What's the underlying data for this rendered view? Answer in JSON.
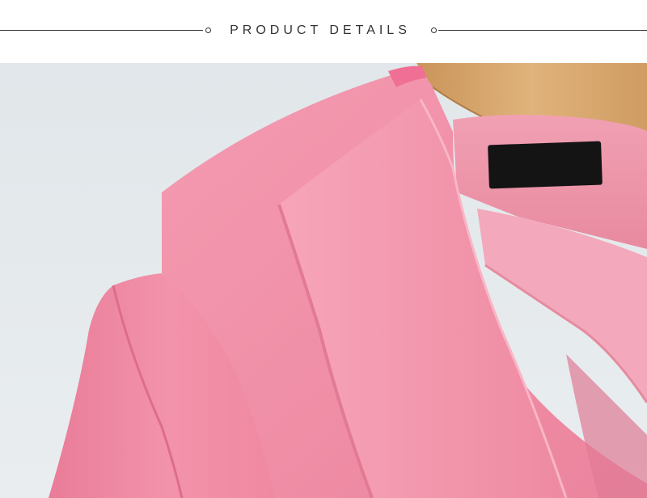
{
  "header": {
    "title": "PRODUCT DETAILS"
  },
  "photo": {
    "subject": "pink-blazer-closeup",
    "colors": {
      "background": "#e4e9ec",
      "fabric": "#f28fa6",
      "fabric_shadow": "#dd6f8a",
      "hanger": "#d8a870",
      "tag": "#141414"
    }
  }
}
